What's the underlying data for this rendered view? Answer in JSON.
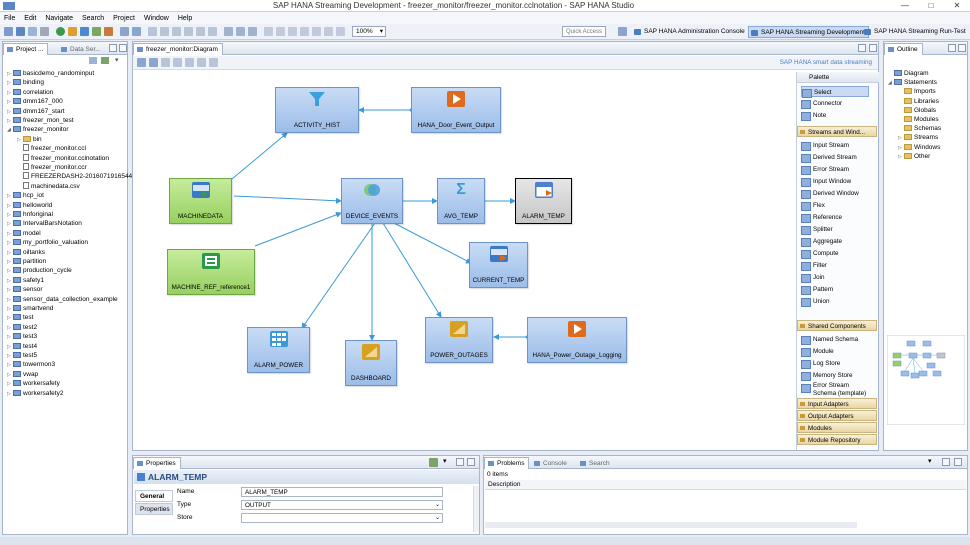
{
  "window": {
    "title": "SAP HANA Streaming Development - freezer_monitor/freezer_monitor.cclnotation - SAP HANA Studio"
  },
  "menu": [
    "File",
    "Edit",
    "Navigate",
    "Search",
    "Project",
    "Window",
    "Help"
  ],
  "toolbar": {
    "zoom": "100%",
    "quick_access_placeholder": "Quick Access"
  },
  "perspectives": [
    "SAP HANA Administration Console",
    "SAP HANA Streaming Development",
    "SAP HANA Streaming Run-Test"
  ],
  "left_panel": {
    "tabs": [
      "Project ...",
      "Data Ser..."
    ],
    "tree": [
      {
        "label": "basicdemo_randominput",
        "level": 0,
        "type": "project"
      },
      {
        "label": "binding",
        "level": 0,
        "type": "project"
      },
      {
        "label": "correlation",
        "level": 0,
        "type": "project"
      },
      {
        "label": "dmm167_000",
        "level": 0,
        "type": "project"
      },
      {
        "label": "dmm167_start",
        "level": 0,
        "type": "project"
      },
      {
        "label": "freezer_mon_test",
        "level": 0,
        "type": "project"
      },
      {
        "label": "freezer_monitor",
        "level": 0,
        "type": "project",
        "open": true
      },
      {
        "label": "bin",
        "level": 1,
        "type": "folder"
      },
      {
        "label": "freezer_monitor.ccl",
        "level": 1,
        "type": "file"
      },
      {
        "label": "freezer_monitor.cclnotation",
        "level": 1,
        "type": "file"
      },
      {
        "label": "freezer_monitor.ccr",
        "level": 1,
        "type": "file"
      },
      {
        "label": "FREEZERDASH2-20160719165447...",
        "level": 1,
        "type": "file"
      },
      {
        "label": "machinedata.csv",
        "level": 1,
        "type": "file"
      },
      {
        "label": "hcp_iot",
        "level": 0,
        "type": "project"
      },
      {
        "label": "helloworld",
        "level": 0,
        "type": "project"
      },
      {
        "label": "hnforiginal",
        "level": 0,
        "type": "project"
      },
      {
        "label": "IntervalBarsNotation",
        "level": 0,
        "type": "project"
      },
      {
        "label": "model",
        "level": 0,
        "type": "project"
      },
      {
        "label": "my_portfolio_valuation",
        "level": 0,
        "type": "project"
      },
      {
        "label": "oiltanks",
        "level": 0,
        "type": "project"
      },
      {
        "label": "partition",
        "level": 0,
        "type": "project"
      },
      {
        "label": "production_cycle",
        "level": 0,
        "type": "project"
      },
      {
        "label": "safety1",
        "level": 0,
        "type": "project"
      },
      {
        "label": "sensor",
        "level": 0,
        "type": "project"
      },
      {
        "label": "sensor_data_collection_example",
        "level": 0,
        "type": "project"
      },
      {
        "label": "smartvend",
        "level": 0,
        "type": "project"
      },
      {
        "label": "test",
        "level": 0,
        "type": "project"
      },
      {
        "label": "test2",
        "level": 0,
        "type": "project"
      },
      {
        "label": "test3",
        "level": 0,
        "type": "project"
      },
      {
        "label": "test4",
        "level": 0,
        "type": "project"
      },
      {
        "label": "test5",
        "level": 0,
        "type": "project"
      },
      {
        "label": "towermon3",
        "level": 0,
        "type": "project"
      },
      {
        "label": "vwap",
        "level": 0,
        "type": "project"
      },
      {
        "label": "workersafety",
        "level": 0,
        "type": "project"
      },
      {
        "label": "workersafety2",
        "level": 0,
        "type": "project"
      }
    ]
  },
  "editor": {
    "tab": "freezer_monitor:Diagram",
    "caption": "SAP HANA smart data streaming",
    "nodes": [
      {
        "id": "activity",
        "label": "ACTIVITY_HIST",
        "icon": "filter-icon",
        "color": "#3aa0e0"
      },
      {
        "id": "door",
        "label": "HANA_Door_Event_Output",
        "icon": "output-adapter-icon",
        "color": "#e06a1c"
      },
      {
        "id": "machine",
        "label": "MACHINEDATA",
        "icon": "input-stream-icon",
        "color": "#3a78c8"
      },
      {
        "id": "device",
        "label": "DEVICE_EVENTS",
        "icon": "union-icon",
        "color": "#4aa0d8"
      },
      {
        "id": "avg",
        "label": "AVG_TEMP",
        "icon": "aggregate-icon",
        "color": "#3a9ad8"
      },
      {
        "id": "alarm",
        "label": "ALARM_TEMP",
        "icon": "window-icon",
        "color": "#4a80d0"
      },
      {
        "id": "machref",
        "label": "MACHINE_REF_reference1",
        "icon": "reference-icon",
        "color": "#2a9a4a"
      },
      {
        "id": "current",
        "label": "CURRENT_TEMP",
        "icon": "output-stream-icon",
        "color": "#3a78c8"
      },
      {
        "id": "alarmpower",
        "label": "ALARM_POWER",
        "icon": "pattern-icon",
        "color": "#3a9ad8"
      },
      {
        "id": "dashboard",
        "label": "DASHBOARD",
        "icon": "flex-icon",
        "color": "#d8a020"
      },
      {
        "id": "outages",
        "label": "POWER_OUTAGES",
        "icon": "flex-icon",
        "color": "#d8a020"
      },
      {
        "id": "logging",
        "label": "HANA_Power_Outage_Logging",
        "icon": "output-adapter-icon",
        "color": "#e06a1c"
      }
    ]
  },
  "palette": {
    "title": "Palette",
    "tools": [
      "Select",
      "Connector",
      "Note"
    ],
    "sections": [
      {
        "title": "Streams and Wind...",
        "items": [
          "Input Stream",
          "Derived Stream",
          "Error Stream",
          "Input Window",
          "Derived Window",
          "Flex",
          "Reference",
          "Splitter",
          "Aggregate",
          "Compute",
          "Filter",
          "Join",
          "Pattern",
          "Union"
        ]
      },
      {
        "title": "Shared Components",
        "items": [
          "Named Schema",
          "Module",
          "Log Store",
          "Memory Store",
          "Error Stream Schema (template)"
        ]
      }
    ],
    "collapsed": [
      "Input Adapters",
      "Output Adapters",
      "Modules",
      "Module Repository"
    ]
  },
  "outline": {
    "tab": "Outline",
    "tree": [
      {
        "label": "Diagram",
        "level": 0
      },
      {
        "label": "Statements",
        "level": 0
      },
      {
        "label": "Imports",
        "level": 1
      },
      {
        "label": "Libraries",
        "level": 1
      },
      {
        "label": "Globals",
        "level": 1
      },
      {
        "label": "Modules",
        "level": 1
      },
      {
        "label": "Schemas",
        "level": 1
      },
      {
        "label": "Streams",
        "level": 1
      },
      {
        "label": "Windows",
        "level": 1
      },
      {
        "label": "Other",
        "level": 1
      }
    ]
  },
  "properties": {
    "tab": "Properties",
    "title": "ALARM_TEMP",
    "side_tabs": [
      "General",
      "Properties"
    ],
    "fields": [
      {
        "label": "Name",
        "value": "ALARM_TEMP"
      },
      {
        "label": "Type",
        "value": "OUTPUT"
      },
      {
        "label": "Store",
        "value": ""
      }
    ]
  },
  "problems": {
    "tabs": [
      "Problems",
      "Console",
      "Search"
    ],
    "count": "0 items",
    "column": "Description"
  }
}
